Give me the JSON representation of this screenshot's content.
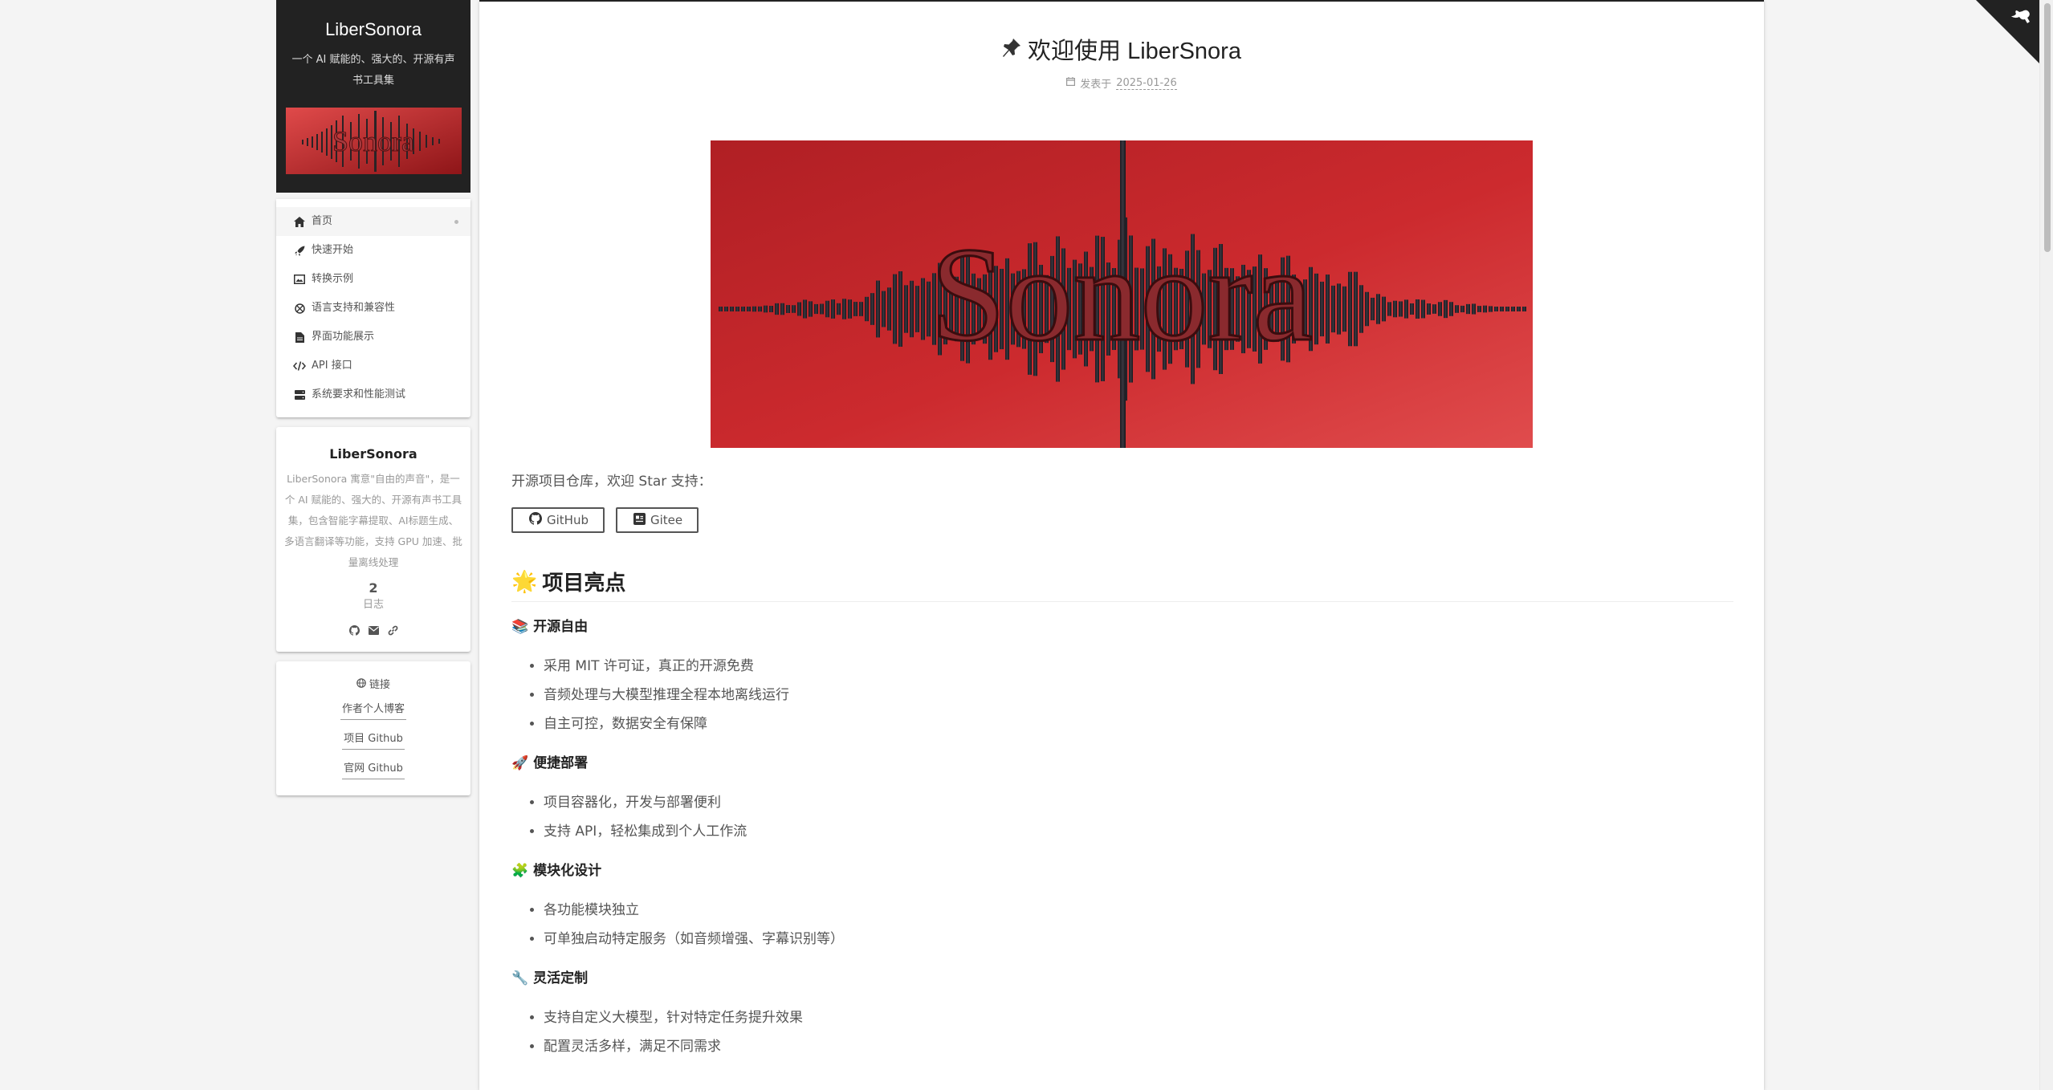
{
  "site": {
    "title": "LiberSonora",
    "subtitle": "一个 AI 赋能的、强大的、开源有声书工具集"
  },
  "menu": {
    "items": [
      {
        "label": "首页",
        "icon": "home-icon",
        "active": true
      },
      {
        "label": "快速开始",
        "icon": "rocket-icon"
      },
      {
        "label": "转换示例",
        "icon": "image-icon"
      },
      {
        "label": "语言支持和兼容性",
        "icon": "globe-icon"
      },
      {
        "label": "界面功能展示",
        "icon": "file-icon"
      },
      {
        "label": "API 接口",
        "icon": "code-icon"
      },
      {
        "label": "系统要求和性能测试",
        "icon": "server-icon"
      }
    ]
  },
  "author": {
    "name": "LiberSonora",
    "description": "LiberSonora 寓意\"自由的声音\"，是一个 AI 赋能的、强大的、开源有声书工具集，包含智能字幕提取、AI标题生成、多语言翻译等功能，支持 GPU 加速、批量离线处理",
    "posts_count": "2",
    "posts_label": "日志",
    "social_icons": [
      "github-icon",
      "email-icon",
      "link-icon"
    ]
  },
  "links": {
    "title": "链接",
    "items": [
      "作者个人博客",
      "项目 Github",
      "官网 Github"
    ]
  },
  "post": {
    "title": "欢迎使用 LiberSnora",
    "meta_label": "发表于",
    "date": "2025-01-26",
    "hero_text": "Sonora",
    "intro": "开源项目仓库，欢迎 Star 支持：",
    "buttons": [
      {
        "label": "GitHub",
        "icon": "github-icon"
      },
      {
        "label": "Gitee",
        "icon": "gitee-icon"
      }
    ],
    "section_title": "项目亮点",
    "section_emoji": "🌟",
    "subsections": [
      {
        "emoji": "📚",
        "title": "开源自由",
        "items": [
          "采用 MIT 许可证，真正的开源免费",
          "音频处理与大模型推理全程本地离线运行",
          "自主可控，数据安全有保障"
        ]
      },
      {
        "emoji": "🚀",
        "title": "便捷部署",
        "items": [
          "项目容器化，开发与部署便利",
          "支持 API，轻松集成到个人工作流"
        ]
      },
      {
        "emoji": "🧩",
        "title": "模块化设计",
        "items": [
          "各功能模块独立",
          "可单独启动特定服务（如音频增强、字幕识别等）"
        ]
      },
      {
        "emoji": "🔧",
        "title": "灵活定制",
        "items": [
          "支持自定义大模型，针对特定任务提升效果",
          "配置灵活多样，满足不同需求"
        ]
      }
    ]
  },
  "colors": {
    "brand_dark": "#222222",
    "hero_red": "#c8282c",
    "text": "#555555"
  }
}
